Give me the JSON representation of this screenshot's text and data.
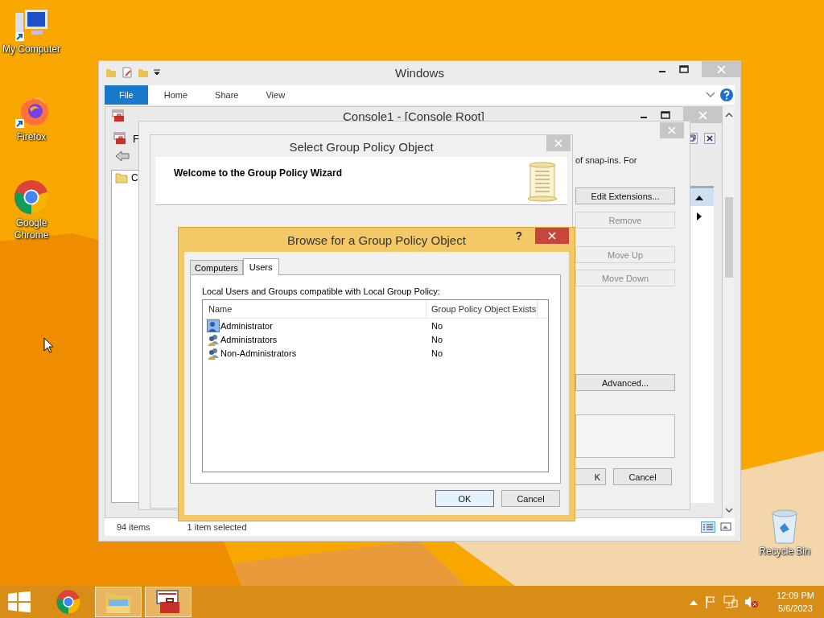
{
  "desktop_icons": [
    {
      "kind": "computer",
      "label": "My Computer"
    },
    {
      "kind": "firefox",
      "label": "Firefox"
    },
    {
      "kind": "chrome",
      "label": "Google Chrome"
    }
  ],
  "recycle_bin": {
    "label": "Recycle Bin"
  },
  "explorer": {
    "title": "Windows",
    "ribbon_tabs": [
      {
        "kind": "file",
        "label": "File",
        "selected": true
      },
      {
        "kind": "tab",
        "label": "Home",
        "selected": false
      },
      {
        "kind": "tab",
        "label": "Share",
        "selected": false
      },
      {
        "kind": "tab",
        "label": "View",
        "selected": false
      }
    ],
    "status_bar": {
      "items": "94 items",
      "selection": "1 item selected"
    }
  },
  "console": {
    "title": "Console1 - [Console Root]",
    "menu_text": "F",
    "tree_item": "C"
  },
  "snapins": {
    "description": "of snap-ins. For",
    "buttons": [
      {
        "label": "Edit Extensions...",
        "disabled": false
      },
      {
        "label": "Remove",
        "disabled": true
      },
      {
        "label": "Move Up",
        "disabled": true
      },
      {
        "label": "Move Down",
        "disabled": true
      },
      {
        "label": "Advanced...",
        "disabled": false
      }
    ],
    "footer_buttons": [
      {
        "label": "K"
      },
      {
        "label": "Cancel"
      }
    ]
  },
  "wizard": {
    "title": "Select Group Policy Object",
    "header": "Welcome to the Group Policy Wizard"
  },
  "browse": {
    "title": "Browse for a Group Policy Object",
    "help": "?",
    "tabs": [
      {
        "label": "Computers",
        "selected": false
      },
      {
        "label": "Users",
        "selected": true
      }
    ],
    "caption": "Local Users and Groups compatible with Local Group Policy:",
    "columns": [
      "Name",
      "Group Policy Object Exists"
    ],
    "rows": [
      {
        "kind": "user",
        "name": "Administrator",
        "exists": "No"
      },
      {
        "kind": "group",
        "name": "Administrators",
        "exists": "No"
      },
      {
        "kind": "group",
        "name": "Non-Administrators",
        "exists": "No"
      }
    ],
    "buttons": [
      {
        "label": "OK",
        "default": true
      },
      {
        "label": "Cancel",
        "default": false
      }
    ]
  },
  "taskbar": {
    "apps": [
      {
        "kind": "chrome",
        "active": false
      },
      {
        "kind": "explorer",
        "active": true
      },
      {
        "kind": "console",
        "active": true
      }
    ],
    "clock": {
      "time": "12:09 PM",
      "date": "5/6/2023"
    }
  }
}
